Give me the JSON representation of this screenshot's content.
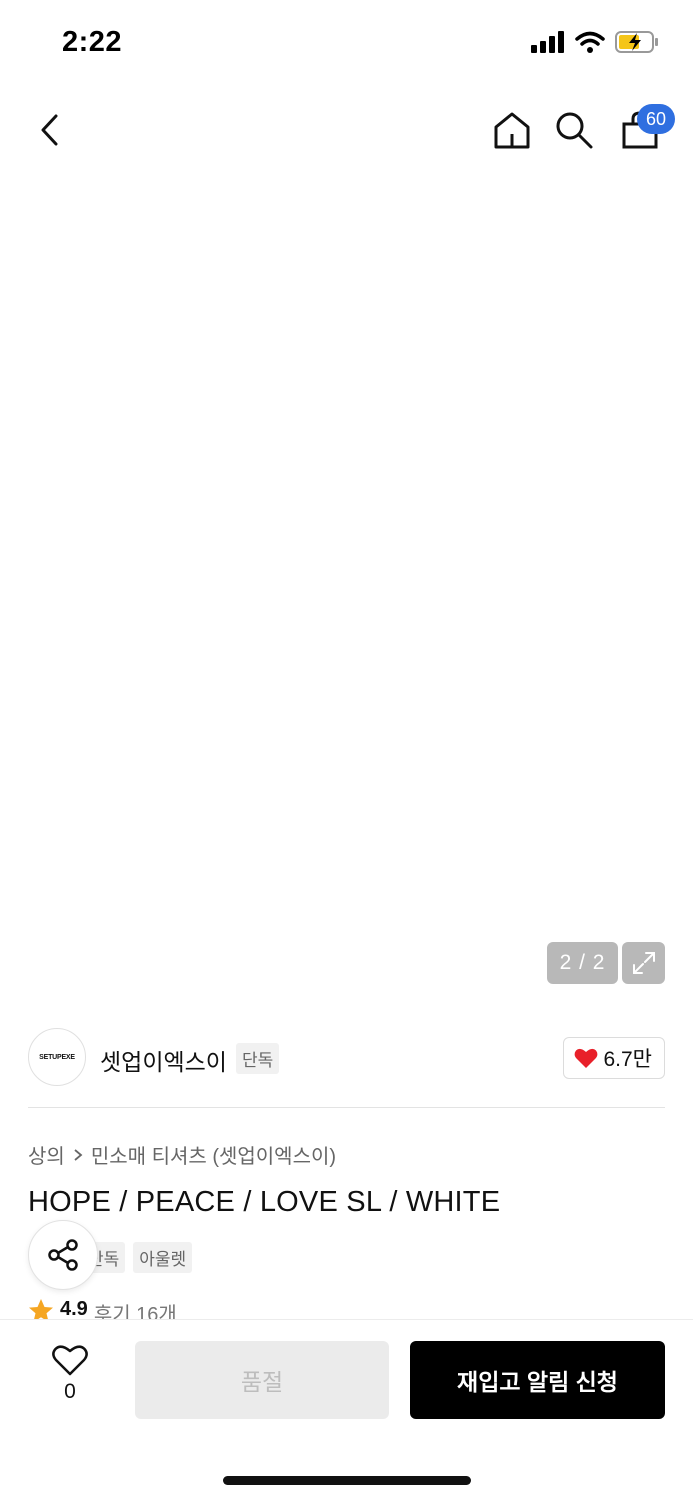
{
  "status_bar": {
    "time": "2:22"
  },
  "nav": {
    "cart_count": "60"
  },
  "gallery": {
    "counter": "2 / 2"
  },
  "brand": {
    "logo_text": "SETUPEXE",
    "name": "셋업이엑스이",
    "tag": "단독",
    "like_count": "6.7만"
  },
  "breadcrumb": {
    "category": "상의",
    "subcategory": "민소매 티셔츠 (셋업이엑스이)"
  },
  "product": {
    "title": "HOPE / PEACE / LOVE SL / WHITE",
    "tags": [
      "단독",
      "아울렛"
    ],
    "rating": "4.9",
    "reviews": "후기 16개"
  },
  "bottom": {
    "wish_count": "0",
    "soldout_label": "품절",
    "restock_label": "재입고 알림 신청"
  },
  "colors": {
    "accent_blue": "#2f6fe0",
    "heart_red": "#e8202a",
    "star_orange": "#f5a623",
    "black": "#000000"
  },
  "icons": [
    "back-icon",
    "home-icon",
    "search-icon",
    "cart-icon",
    "expand-icon",
    "heart-icon",
    "share-icon",
    "star-icon",
    "heart-outline-icon",
    "signal-icon",
    "wifi-icon",
    "battery-icon"
  ]
}
